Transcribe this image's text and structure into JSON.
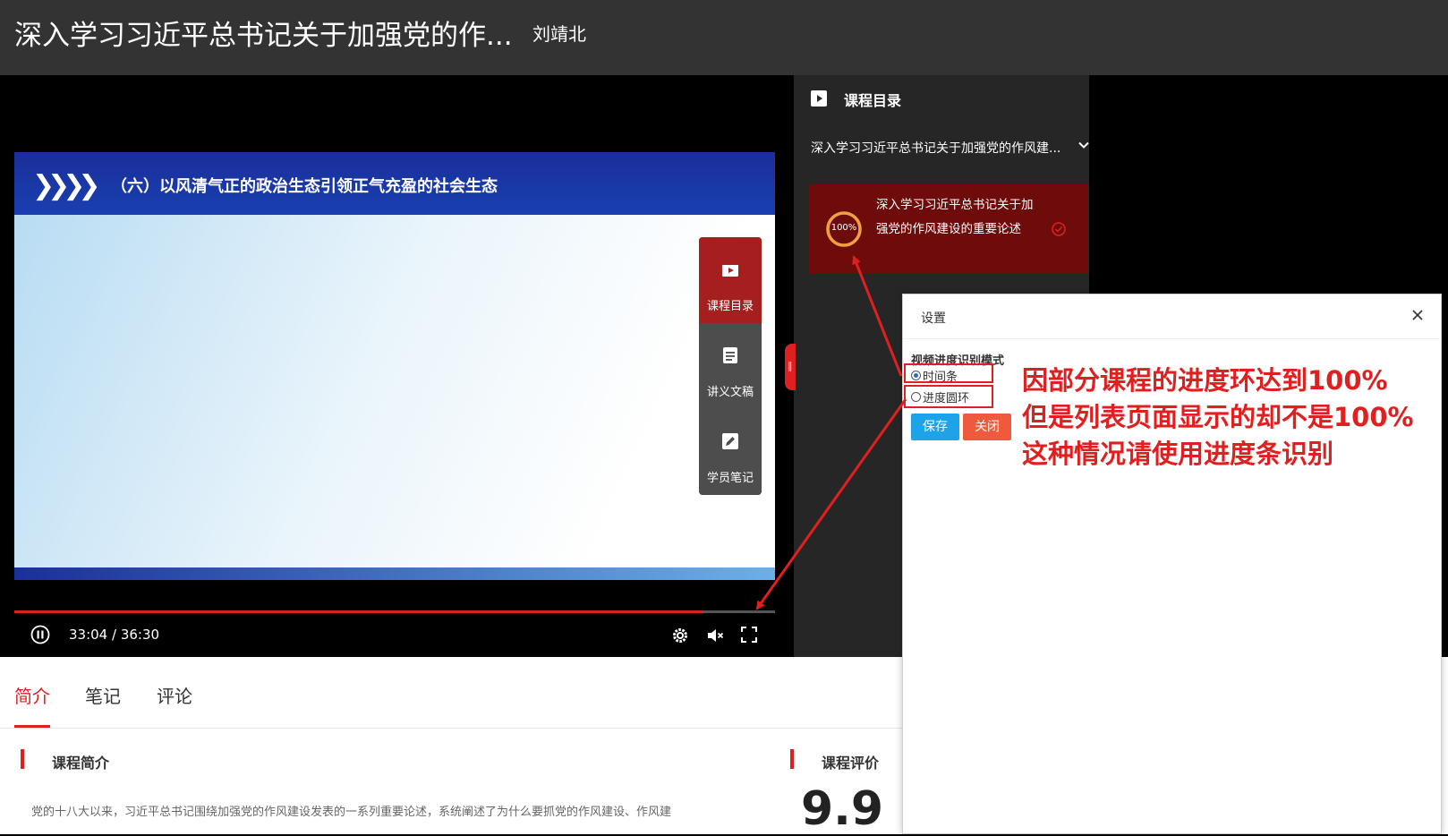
{
  "header": {
    "title": "深入学习习近平总书记关于加强党的作...",
    "author": "刘靖北"
  },
  "video": {
    "slide_title": "（六）以风清气正的政治生态引领正气充盈的社会生态",
    "time": "33:04 / 36:30",
    "progress": 0.906,
    "tools": [
      {
        "label": "课程目录",
        "icon": "clapper-icon"
      },
      {
        "label": "讲义文稿",
        "icon": "document-icon"
      },
      {
        "label": "学员笔记",
        "icon": "pencil-icon"
      }
    ]
  },
  "catalog": {
    "header": "课程目录",
    "dropdown": "深入学习习近平总书记关于加强党的作风建...",
    "item": {
      "title": "深入学习习近平总书记关于加强党的作风建设的重要论述",
      "percent": "100%",
      "progress": 1.0
    }
  },
  "tabs": [
    {
      "label": "简介"
    },
    {
      "label": "笔记"
    },
    {
      "label": "评论"
    }
  ],
  "intro": {
    "section_title": "课程简介",
    "text": "党的十八大以来，习近平总书记围绕加强党的作风建设发表的一系列重要论述，系统阐述了为什么要抓党的作风建设、作风建"
  },
  "rating": {
    "section_title": "课程评价",
    "score": "9.9"
  },
  "dialog": {
    "title": "设置",
    "mode_label": "视频进度识别模式",
    "options": [
      {
        "label": "时间条",
        "selected": true
      },
      {
        "label": "进度圆环",
        "selected": false
      }
    ],
    "save": "保存",
    "close": "关闭"
  },
  "annotation": {
    "lines": [
      "因部分课程的进度环达到100%",
      "但是列表页面显示的却不是100%",
      "这种情况请使用进度条识别"
    ]
  },
  "colors": {
    "accent": "#e02020",
    "catalog_item_bg": "#6e0b0b",
    "save_button": "#1fa3e8",
    "close_button": "#f05a3c"
  }
}
